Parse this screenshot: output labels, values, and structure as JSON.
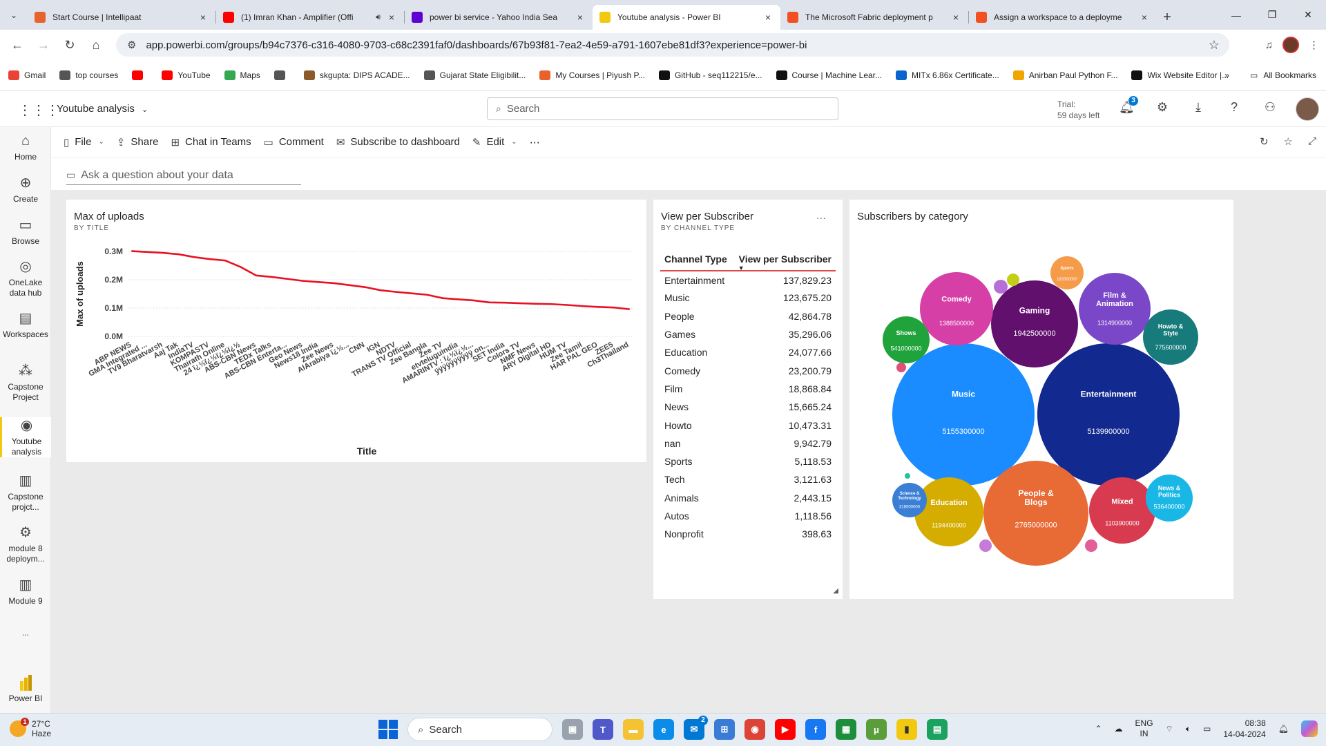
{
  "browser": {
    "tabs": [
      {
        "title": "Start Course | Intellipaat",
        "favicon_color": "#e8622c",
        "active": false,
        "audio": false
      },
      {
        "title": "(1) Imran Khan - Amplifier (Offi",
        "favicon_color": "#ff0000",
        "active": false,
        "audio": true
      },
      {
        "title": "power bi service - Yahoo India Sea",
        "favicon_color": "#5f01d1",
        "active": false,
        "audio": false
      },
      {
        "title": "Youtube analysis - Power BI",
        "favicon_color": "#f2c811",
        "active": true,
        "audio": false
      },
      {
        "title": "The Microsoft Fabric deployment p",
        "favicon_color": "#f25022",
        "active": false,
        "audio": false
      },
      {
        "title": "Assign a workspace to a deployme",
        "favicon_color": "#f25022",
        "active": false,
        "audio": false
      }
    ],
    "url": "app.powerbi.com/groups/b94c7376-c316-4080-9703-c68c2391faf0/dashboards/67b93f81-7ea2-4e59-a791-1607ebe81df3?experience=power-bi",
    "bookmarks": [
      {
        "label": "Gmail",
        "color": "#ea4335"
      },
      {
        "label": "top courses",
        "color": "#555555"
      },
      {
        "label": "",
        "color": "#ff0000"
      },
      {
        "label": "YouTube",
        "color": "#ff0000"
      },
      {
        "label": "Maps",
        "color": "#34a853"
      },
      {
        "label": "",
        "color": "#555555"
      },
      {
        "label": "skgupta: DIPS ACADE...",
        "color": "#8b5a2b"
      },
      {
        "label": "Gujarat State Eligibilit...",
        "color": "#555555"
      },
      {
        "label": "My Courses | Piyush P...",
        "color": "#e8622c"
      },
      {
        "label": "GitHub - seq112215/e...",
        "color": "#111111"
      },
      {
        "label": "Course | Machine Lear...",
        "color": "#111111"
      },
      {
        "label": "MITx 6.86x Certificate...",
        "color": "#0b63ce"
      },
      {
        "label": "Anirban Paul Python F...",
        "color": "#f0a500"
      },
      {
        "label": "Wix Website Editor |...",
        "color": "#111111"
      }
    ],
    "all_bookmarks": "All Bookmarks"
  },
  "header": {
    "workspace_title": "Youtube analysis",
    "search_placeholder": "Search",
    "trial_line1": "Trial:",
    "trial_line2": "59 days left",
    "notification_count": "3"
  },
  "leftnav": [
    {
      "label": "Home",
      "icon": "home-icon",
      "glyph": "⌂"
    },
    {
      "label": "Create",
      "icon": "create-icon",
      "glyph": "⊕"
    },
    {
      "label": "Browse",
      "icon": "browse-icon",
      "glyph": "▭"
    },
    {
      "label": "OneLake data hub",
      "icon": "onelake-icon",
      "glyph": "◎"
    },
    {
      "label": "Workspaces",
      "icon": "workspaces-icon",
      "glyph": "▤"
    },
    {
      "label": "Capstone Project",
      "icon": "capstone-icon",
      "glyph": "⁂"
    },
    {
      "label": "Youtube analysis",
      "icon": "youtube-analysis-icon",
      "glyph": "◉"
    },
    {
      "label": "Capstone projct...",
      "icon": "report-icon",
      "glyph": "▥"
    },
    {
      "label": "module 8 deploym...",
      "icon": "deployment-icon",
      "glyph": "⚙"
    },
    {
      "label": "Module 9",
      "icon": "report-icon",
      "glyph": "▥"
    },
    {
      "label": "...",
      "icon": "more-icon",
      "glyph": ""
    },
    {
      "label": "Power BI",
      "icon": "powerbi-logo-icon",
      "glyph": ""
    }
  ],
  "actionbar": {
    "file": "File",
    "share": "Share",
    "chat": "Chat in Teams",
    "comment": "Comment",
    "subscribe": "Subscribe to dashboard",
    "edit": "Edit",
    "more": "⋯"
  },
  "qna_placeholder": "Ask a question about your data",
  "tiles": {
    "uploads": {
      "title": "Max of uploads",
      "subtitle": "BY TITLE"
    },
    "vps": {
      "title": "View per Subscriber",
      "subtitle": "BY CHANNEL TYPE",
      "more": "···"
    },
    "bubbles": {
      "title": "Subscribers by category"
    }
  },
  "chart_data": [
    {
      "type": "line",
      "title": "Max of uploads",
      "subtitle": "BY TITLE",
      "xlabel": "Title",
      "ylabel": "Max of uploads",
      "ylim": [
        0,
        300000
      ],
      "yticks": [
        "0.0M",
        "0.1M",
        "0.2M",
        "0.3M"
      ],
      "color": "#e81123",
      "categories": [
        "ABP NEWS",
        "GMA Integrated ...",
        "TV9 Bharatvarsh",
        "Aaj Tak",
        "IndiaTV",
        "KOMPASTV",
        "Thairath Online",
        "24 ï¿½ï¿½ï¿½ï¿½",
        "ABS-CBN News",
        "TEDx Talks",
        "ABS-CBN Enterta...",
        "Geo News",
        "News18 India",
        "Zee News",
        "AlArabiya ï¿½...",
        "CNN",
        "IGN",
        "NDTV",
        "TRANS TV Official",
        "Zee Bangla",
        "Zee TV",
        "etvteluguindia",
        "AMARINTV : ï¿½ï¿½...",
        "ÿÿÿÿÿÿÿÿÿÿ on...",
        "SET India",
        "Colors TV",
        "NMF News",
        "ARY Digital HD",
        "HUM TV",
        "Zee Tamil",
        "HAR PAL GEO",
        "ZEE5",
        "Ch3Thailand"
      ],
      "values": [
        301000,
        298000,
        295000,
        290000,
        280000,
        273000,
        268000,
        245000,
        215000,
        210000,
        203000,
        196000,
        192000,
        188000,
        181000,
        174000,
        163000,
        157000,
        152000,
        147000,
        135000,
        131000,
        127000,
        120000,
        119000,
        117000,
        115000,
        114000,
        111000,
        107000,
        104000,
        102000,
        96000
      ]
    },
    {
      "type": "table",
      "title": "View per Subscriber",
      "subtitle": "BY CHANNEL TYPE",
      "columns": [
        "Channel Type",
        "View per Subscriber"
      ],
      "rows": [
        [
          "Entertainment",
          "137,829.23"
        ],
        [
          "Music",
          "123,675.20"
        ],
        [
          "People",
          "42,864.78"
        ],
        [
          "Games",
          "35,296.06"
        ],
        [
          "Education",
          "24,077.66"
        ],
        [
          "Comedy",
          "23,200.79"
        ],
        [
          "Film",
          "18,868.84"
        ],
        [
          "News",
          "15,665.24"
        ],
        [
          "Howto",
          "10,473.31"
        ],
        [
          "nan",
          "9,942.79"
        ],
        [
          "Sports",
          "5,118.53"
        ],
        [
          "Tech",
          "3,121.63"
        ],
        [
          "Animals",
          "2,443.15"
        ],
        [
          "Autos",
          "1,118.56"
        ],
        [
          "Nonprofit",
          "398.63"
        ]
      ]
    },
    {
      "type": "bubble",
      "title": "Subscribers by category",
      "bubbles": [
        {
          "label": "Music",
          "value": "5155300000",
          "color": "#1a8cff"
        },
        {
          "label": "Entertainment",
          "value": "5139900000",
          "color": "#122a8f"
        },
        {
          "label": "People & Blogs",
          "value": "2765000000",
          "color": "#e86a35"
        },
        {
          "label": "Gaming",
          "value": "1942500000",
          "color": "#62106e"
        },
        {
          "label": "Comedy",
          "value": "1388500000",
          "color": "#d63fa6"
        },
        {
          "label": "Film & Animation",
          "value": "1314900000",
          "color": "#7b47c9"
        },
        {
          "label": "Education",
          "value": "1194400000",
          "color": "#d4ad00"
        },
        {
          "label": "Mixed",
          "value": "1103900000",
          "color": "#d83b50"
        },
        {
          "label": "Howto & Style",
          "value": "775600000",
          "color": "#177a7b"
        },
        {
          "label": "Shows",
          "value": "541000000",
          "color": "#1fa33a"
        },
        {
          "label": "News & Politics",
          "value": "536400000",
          "color": "#19b7e6"
        },
        {
          "label": "Science & Technology",
          "value": "318500000",
          "color": "#3a7fd5"
        },
        {
          "label": "Sports",
          "value": "183300000",
          "color": "#f59b4a"
        },
        {
          "label": "",
          "value": "",
          "color": "#c3cf16"
        },
        {
          "label": "",
          "value": "",
          "color": "#b56fd6"
        },
        {
          "label": "",
          "value": "",
          "color": "#e24f7a"
        },
        {
          "label": "",
          "value": "",
          "color": "#c77bd8"
        },
        {
          "label": "",
          "value": "",
          "color": "#e25f9a"
        },
        {
          "label": "",
          "value": "",
          "color": "#26c0a8"
        }
      ]
    }
  ],
  "taskbar": {
    "temp": "27°C",
    "weather": "Haze",
    "weather_badge": "1",
    "search": "Search",
    "lang1": "ENG",
    "lang2": "IN",
    "time": "08:38",
    "date": "14-04-2024",
    "teams_badge": "2"
  }
}
